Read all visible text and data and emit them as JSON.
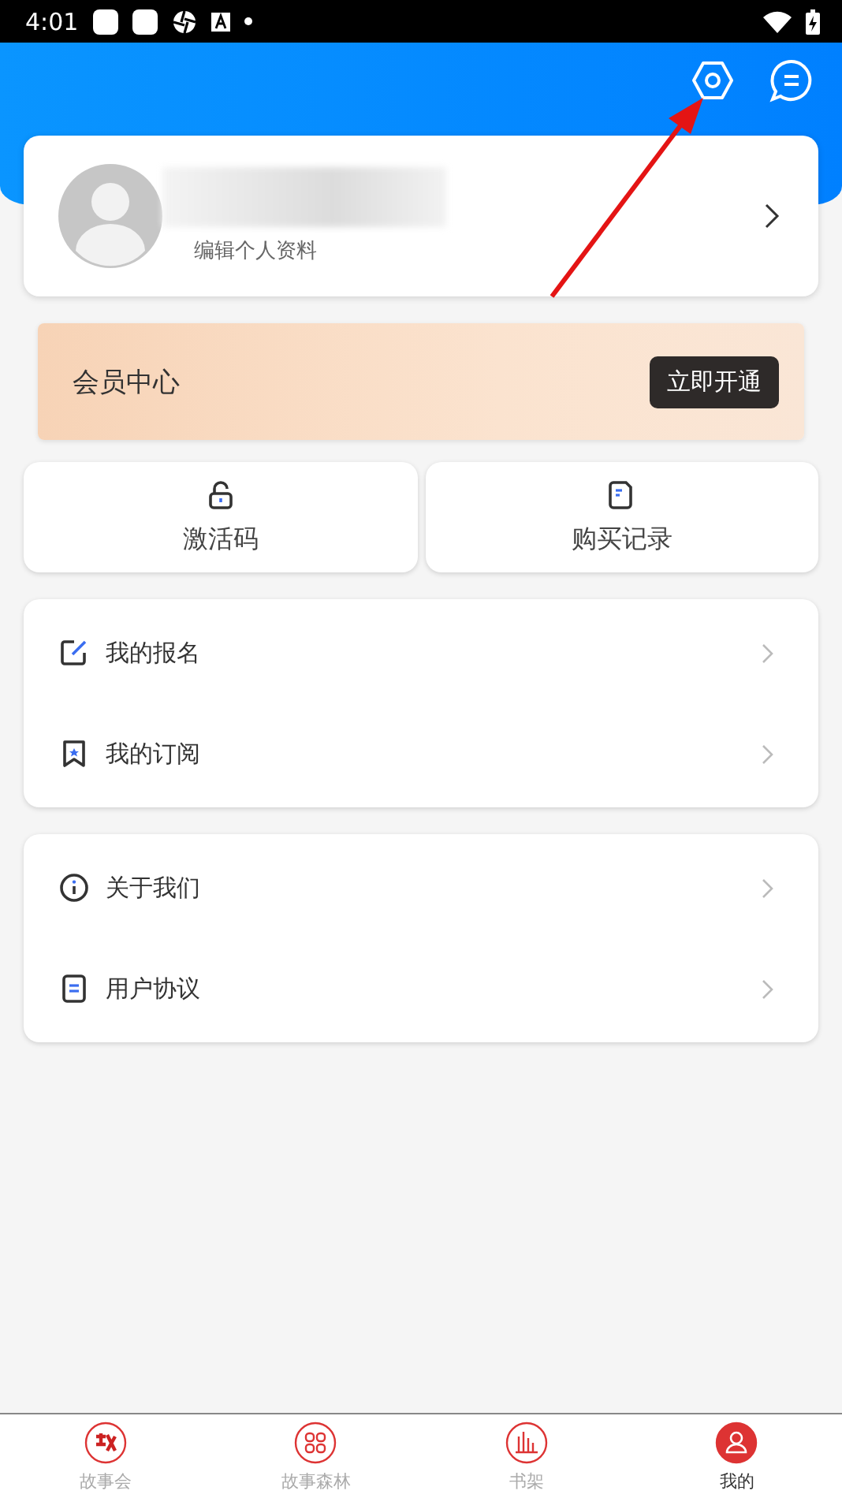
{
  "status_bar": {
    "time": "4:01"
  },
  "profile": {
    "subtitle": "编辑个人资料"
  },
  "membership": {
    "title": "会员中心",
    "button": "立即开通"
  },
  "shortcuts": [
    {
      "label": "激活码",
      "kind": "lock"
    },
    {
      "label": "购买记录",
      "kind": "receipt"
    }
  ],
  "menu_groups": [
    {
      "items": [
        {
          "label": "我的报名",
          "kind": "edit"
        },
        {
          "label": "我的订阅",
          "kind": "bookmark"
        }
      ]
    },
    {
      "items": [
        {
          "label": "关于我们",
          "kind": "info"
        },
        {
          "label": "用户协议",
          "kind": "doc"
        }
      ]
    }
  ],
  "bottom_nav": [
    {
      "label": "故事会",
      "kind": "story",
      "selected": false
    },
    {
      "label": "故事森林",
      "kind": "forest",
      "selected": false
    },
    {
      "label": "书架",
      "kind": "shelf",
      "selected": false
    },
    {
      "label": "我的",
      "kind": "me",
      "selected": true
    }
  ]
}
